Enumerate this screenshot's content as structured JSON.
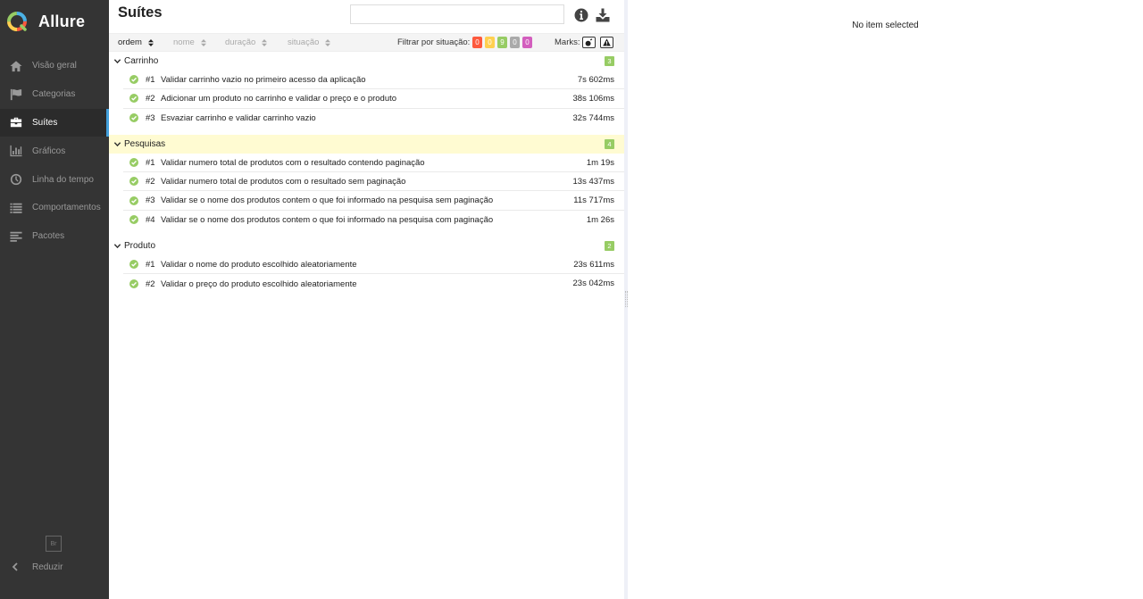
{
  "app": {
    "name": "Allure"
  },
  "sidebar": {
    "items": [
      {
        "label": "Visão geral",
        "icon": "home-icon",
        "active": false
      },
      {
        "label": "Categorias",
        "icon": "flag-icon",
        "active": false
      },
      {
        "label": "Suítes",
        "icon": "briefcase-icon",
        "active": true
      },
      {
        "label": "Gráficos",
        "icon": "bar-chart-icon",
        "active": false
      },
      {
        "label": "Linha do tempo",
        "icon": "clock-icon",
        "active": false
      },
      {
        "label": "Comportamentos",
        "icon": "list-icon",
        "active": false
      },
      {
        "label": "Pacotes",
        "icon": "align-left-icon",
        "active": false
      }
    ],
    "language": "Br",
    "collapse_label": "Reduzir"
  },
  "main": {
    "title": "Suítes",
    "search": {
      "value": "",
      "placeholder": ""
    },
    "sort": {
      "order": "ordem",
      "name": "nome",
      "duration": "duração",
      "status": "situação"
    },
    "filter_label": "Filtrar por situação:",
    "status_counts": [
      {
        "name": "failed",
        "value": "0",
        "color": "#fd5a3e"
      },
      {
        "name": "broken",
        "value": "0",
        "color": "#ffd050"
      },
      {
        "name": "passed",
        "value": "9",
        "color": "#97cc64"
      },
      {
        "name": "skipped",
        "value": "0",
        "color": "#aaaaaa"
      },
      {
        "name": "unknown",
        "value": "0",
        "color": "#d35ebe"
      }
    ],
    "marks_label": "Marks:",
    "groups": [
      {
        "name": "Carrinho",
        "count": "3",
        "highlight": false,
        "tests": [
          {
            "num": "#1",
            "name": "Validar carrinho vazio no primeiro acesso da aplicação",
            "duration": "7s 602ms"
          },
          {
            "num": "#2",
            "name": "Adicionar um produto no carrinho e validar o preço e o produto",
            "duration": "38s 106ms"
          },
          {
            "num": "#3",
            "name": "Esvaziar carrinho e validar carrinho vazio",
            "duration": "32s 744ms"
          }
        ]
      },
      {
        "name": "Pesquisas",
        "count": "4",
        "highlight": true,
        "tests": [
          {
            "num": "#1",
            "name": "Validar numero total de produtos com o resultado contendo paginação",
            "duration": "1m 19s"
          },
          {
            "num": "#2",
            "name": "Validar numero total de produtos com o resultado sem paginação",
            "duration": "13s 437ms"
          },
          {
            "num": "#3",
            "name": "Validar se o nome dos produtos contem o que foi informado na pesquisa sem paginação",
            "duration": "11s 717ms"
          },
          {
            "num": "#4",
            "name": "Validar se o nome dos produtos contem o que foi informado na pesquisa com paginação",
            "duration": "1m 26s"
          }
        ]
      },
      {
        "name": "Produto",
        "count": "2",
        "highlight": false,
        "tests": [
          {
            "num": "#1",
            "name": "Validar o nome do produto escolhido aleatoriamente",
            "duration": "23s 611ms"
          },
          {
            "num": "#2",
            "name": "Validar o preço do produto escolhido aleatoriamente",
            "duration": "23s 042ms"
          }
        ]
      }
    ]
  },
  "detail": {
    "empty_text": "No item selected"
  },
  "colors": {
    "sidebar_bg": "#343434",
    "active_accent": "#43a0dc",
    "passed": "#97cc64",
    "highlight_row": "#fffbd2"
  }
}
